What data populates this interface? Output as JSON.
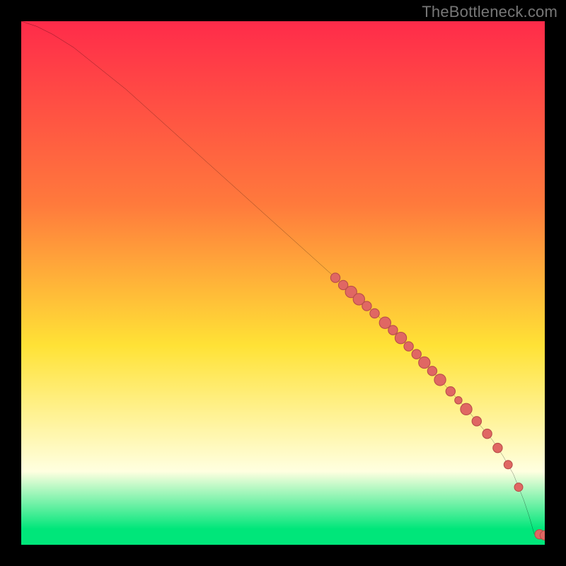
{
  "watermark": "TheBottleneck.com",
  "colors": {
    "background": "#000000",
    "watermark_text": "#777777",
    "curve": "#000000",
    "point_fill": "#e06763",
    "point_stroke": "#b94e4a",
    "gradient_top": "#ff2b4a",
    "gradient_orange": "#ff7a3c",
    "gradient_yellow": "#ffe236",
    "gradient_pale": "#ffffe0",
    "gradient_green": "#00e67a"
  },
  "chart_data": {
    "type": "line",
    "title": "",
    "xlabel": "",
    "ylabel": "",
    "xlim": [
      0,
      100
    ],
    "ylim": [
      0,
      100
    ],
    "curve": {
      "x": [
        0,
        3,
        6,
        10,
        20,
        30,
        40,
        50,
        60,
        65,
        70,
        75,
        80,
        85,
        90,
        92,
        94,
        95,
        96,
        97,
        98,
        100
      ],
      "y": [
        100,
        99,
        97.5,
        95,
        87,
        78,
        69,
        60,
        51,
        46.5,
        42,
        37,
        31.5,
        26,
        20,
        17,
        13.5,
        11,
        8.5,
        5.5,
        2,
        1.8
      ]
    },
    "points": [
      {
        "x": 60.0,
        "y": 51.0,
        "r": 0.9
      },
      {
        "x": 61.5,
        "y": 49.6,
        "r": 0.9
      },
      {
        "x": 63.0,
        "y": 48.3,
        "r": 1.1
      },
      {
        "x": 64.5,
        "y": 46.9,
        "r": 1.1
      },
      {
        "x": 66.0,
        "y": 45.6,
        "r": 0.9
      },
      {
        "x": 67.5,
        "y": 44.2,
        "r": 0.9
      },
      {
        "x": 69.5,
        "y": 42.4,
        "r": 1.1
      },
      {
        "x": 71.0,
        "y": 41.0,
        "r": 0.9
      },
      {
        "x": 72.5,
        "y": 39.5,
        "r": 1.1
      },
      {
        "x": 74.0,
        "y": 37.9,
        "r": 0.9
      },
      {
        "x": 75.5,
        "y": 36.4,
        "r": 0.9
      },
      {
        "x": 77.0,
        "y": 34.8,
        "r": 1.1
      },
      {
        "x": 78.5,
        "y": 33.2,
        "r": 0.9
      },
      {
        "x": 80.0,
        "y": 31.5,
        "r": 1.1
      },
      {
        "x": 82.0,
        "y": 29.3,
        "r": 0.9
      },
      {
        "x": 83.5,
        "y": 27.6,
        "r": 0.7
      },
      {
        "x": 85.0,
        "y": 25.9,
        "r": 1.1
      },
      {
        "x": 87.0,
        "y": 23.6,
        "r": 0.9
      },
      {
        "x": 89.0,
        "y": 21.2,
        "r": 0.9
      },
      {
        "x": 91.0,
        "y": 18.5,
        "r": 0.9
      },
      {
        "x": 93.0,
        "y": 15.3,
        "r": 0.8
      },
      {
        "x": 95.0,
        "y": 11.0,
        "r": 0.8
      },
      {
        "x": 99.0,
        "y": 2.0,
        "r": 0.9
      },
      {
        "x": 100.0,
        "y": 1.8,
        "r": 0.9
      }
    ]
  }
}
